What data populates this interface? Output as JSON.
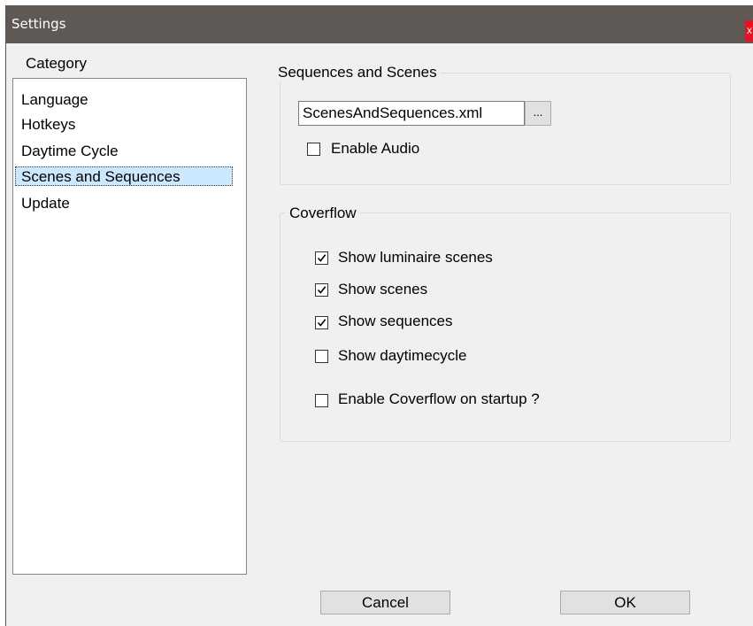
{
  "window": {
    "title": "Settings",
    "close_label": "x"
  },
  "category": {
    "label": "Category",
    "items": [
      {
        "label": "Language"
      },
      {
        "label": "Hotkeys"
      },
      {
        "label": "Daytime Cycle"
      },
      {
        "label": "Scenes and Sequences",
        "selected": true
      },
      {
        "label": "Update"
      }
    ]
  },
  "sequences_group": {
    "legend": "Sequences and Scenes",
    "file_value": "ScenesAndSequences.xml",
    "browse_label": "...",
    "enable_audio": {
      "label": "Enable Audio",
      "checked": false
    }
  },
  "coverflow_group": {
    "legend": "Coverflow",
    "options": [
      {
        "label": "Show luminaire scenes",
        "checked": true
      },
      {
        "label": "Show scenes",
        "checked": true
      },
      {
        "label": "Show sequences",
        "checked": true
      },
      {
        "label": "Show daytimecycle",
        "checked": false
      },
      {
        "label": "Enable Coverflow on startup ?",
        "checked": false
      }
    ]
  },
  "buttons": {
    "cancel": "Cancel",
    "ok": "OK"
  },
  "colors": {
    "titlebar": "#5f5956",
    "close": "#e81123",
    "selection": "#cce8ff",
    "dialog_bg": "#f0f0f0"
  }
}
